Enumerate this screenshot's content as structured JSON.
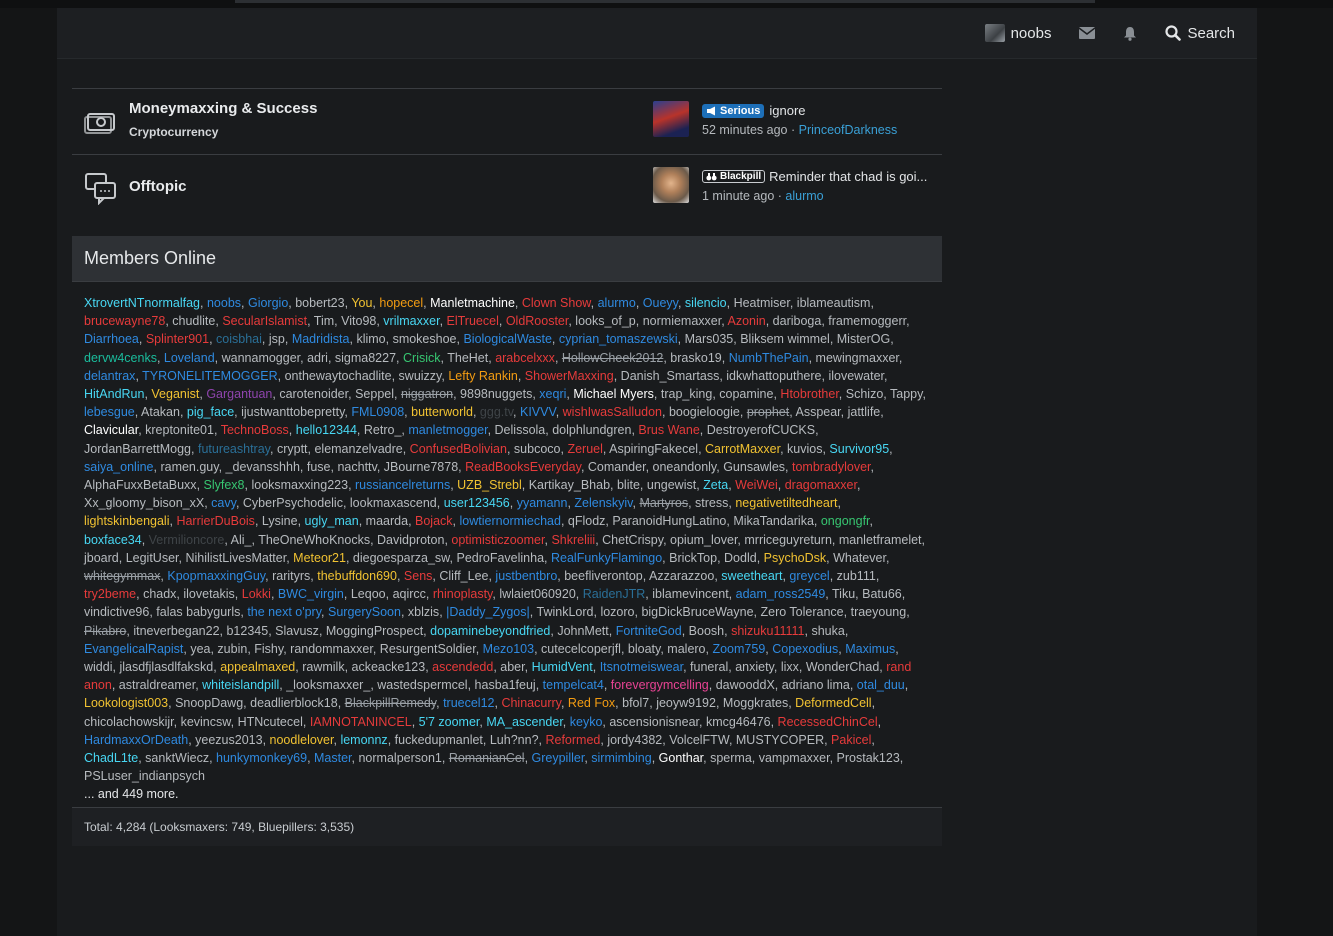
{
  "navbar": {
    "username": "noobs",
    "search_label": "Search",
    "icons": [
      "envelope-icon",
      "bell-icon",
      "search-icon"
    ]
  },
  "nodes": [
    {
      "title": "Moneymaxxing & Success",
      "subforum": "Cryptocurrency",
      "icon": "money-icon",
      "latest": {
        "prefix": "Serious",
        "thread_title": "ignore",
        "time": "52 minutes ago",
        "author": "PrinceofDarkness"
      }
    },
    {
      "title": "Offtopic",
      "icon": "chat-bubbles-icon",
      "latest": {
        "prefix": "Blackpill",
        "thread_title": "Reminder that chad is goi...",
        "time": "1 minute ago",
        "author": "alurmo"
      }
    }
  ],
  "members_online": {
    "heading": "Members Online",
    "more": "... and 449 more.",
    "total": "Total: 4,284 (Looksmaxers: 749, Bluepillers: 3,535)",
    "users": [
      [
        "XtrovertNTnormalfag",
        "cyan"
      ],
      [
        "noobs",
        "blue"
      ],
      [
        "Giorgio",
        "blue"
      ],
      [
        "bobert23",
        "def"
      ],
      [
        "You",
        "yellow"
      ],
      [
        "hopecel",
        "orange"
      ],
      [
        "Manletmachine",
        "white"
      ],
      [
        "Clown Show",
        "red"
      ],
      [
        "alurmo",
        "blue"
      ],
      [
        "Oueyy",
        "blue"
      ],
      [
        "silencio",
        "cyan"
      ],
      [
        "Heatmiser",
        "def"
      ],
      [
        "iblameautism",
        "def"
      ],
      [
        "brucewayne78",
        "red"
      ],
      [
        "chudlite",
        "def"
      ],
      [
        "SecularIslamist",
        "red"
      ],
      [
        "Tim",
        "def"
      ],
      [
        "Vito98",
        "def"
      ],
      [
        "vrilmaxxer",
        "cyan"
      ],
      [
        "ElTruecel",
        "red"
      ],
      [
        "OldRooster",
        "red"
      ],
      [
        "looks_of_p",
        "def"
      ],
      [
        "normiemaxxer",
        "def"
      ],
      [
        "Azonin",
        "red"
      ],
      [
        "dariboga",
        "def"
      ],
      [
        "framemoggerr",
        "def"
      ],
      [
        "Diarrhoea",
        "blue"
      ],
      [
        "Splinter901",
        "red"
      ],
      [
        "coisbhai",
        "dimblue"
      ],
      [
        "jsp",
        "def"
      ],
      [
        "Madridista",
        "blue"
      ],
      [
        "klimo",
        "def"
      ],
      [
        "smokeshoe",
        "def"
      ],
      [
        "BiologicalWaste",
        "blue"
      ],
      [
        "cyprian_tomaszewski",
        "blue"
      ],
      [
        "Mars035",
        "def"
      ],
      [
        "Bliksem wimmel",
        "def"
      ],
      [
        "MisterOG",
        "def"
      ],
      [
        "dervw4cenks",
        "teal"
      ],
      [
        "Loveland",
        "blue"
      ],
      [
        "wannamogger",
        "def"
      ],
      [
        "adri",
        "def"
      ],
      [
        "sigma8227",
        "def"
      ],
      [
        "Crisick",
        "green"
      ],
      [
        "TheHet",
        "def"
      ],
      [
        "arabcelxxx",
        "red"
      ],
      [
        "HollowCheek2012",
        "strike"
      ],
      [
        "brasko19",
        "def"
      ],
      [
        "NumbThePain",
        "blue"
      ],
      [
        "mewingmaxxer",
        "def"
      ],
      [
        "delantrax",
        "blue"
      ],
      [
        "TYRONELITEMOGGER",
        "blue"
      ],
      [
        "onthewaytochadlite",
        "def"
      ],
      [
        "swuizzy",
        "def"
      ],
      [
        "Lefty Rankin",
        "orange"
      ],
      [
        "ShowerMaxxing",
        "red"
      ],
      [
        "Danish_Smartass",
        "def"
      ],
      [
        "idkwhattoputhere",
        "def"
      ],
      [
        "ilovewater",
        "def"
      ],
      [
        "HitAndRun",
        "cyan"
      ],
      [
        "Veganist",
        "yellow"
      ],
      [
        "Gargantuan",
        "purple"
      ],
      [
        "carotenoider",
        "def"
      ],
      [
        "Seppel",
        "def"
      ],
      [
        "niggatron",
        "strike"
      ],
      [
        "9898nuggets",
        "def"
      ],
      [
        "xeqri",
        "blue"
      ],
      [
        "Michael Myers",
        "white"
      ],
      [
        "trap_king",
        "def"
      ],
      [
        "copamine",
        "def"
      ],
      [
        "Htobrother",
        "red"
      ],
      [
        "Schizo",
        "def"
      ],
      [
        "Tappy",
        "def"
      ],
      [
        "lebesgue",
        "blue"
      ],
      [
        "Atakan",
        "def"
      ],
      [
        "pig_face",
        "cyan"
      ],
      [
        "ijustwanttobepretty",
        "def"
      ],
      [
        "FML0908",
        "blue"
      ],
      [
        "butterworld",
        "yellow"
      ],
      [
        "ggg.tv",
        "dark"
      ],
      [
        "KIVVV",
        "blue"
      ],
      [
        "wishIwasSalludon",
        "red"
      ],
      [
        "boogieloogie",
        "def"
      ],
      [
        "prophet",
        "strike"
      ],
      [
        "Asspear",
        "def"
      ],
      [
        "jattlife",
        "def"
      ],
      [
        "Clavicular",
        "white"
      ],
      [
        "kreptonite01",
        "def"
      ],
      [
        "TechnoBoss",
        "red"
      ],
      [
        "hello12344",
        "cyan"
      ],
      [
        "Retro_",
        "def"
      ],
      [
        "manletmogger",
        "blue"
      ],
      [
        "Delissola",
        "def"
      ],
      [
        "dolphlundgren",
        "def"
      ],
      [
        "Brus Wane",
        "red"
      ],
      [
        "DestroyerofCUCKS",
        "def"
      ],
      [
        "JordanBarrettMogg",
        "def"
      ],
      [
        "futureashtray",
        "dimblue"
      ],
      [
        "cryptt",
        "def"
      ],
      [
        "elemanzelvadre",
        "def"
      ],
      [
        "ConfusedBolivian",
        "red"
      ],
      [
        "subcoco",
        "def"
      ],
      [
        "Zeruel",
        "red"
      ],
      [
        "AspiringFakecel",
        "def"
      ],
      [
        "CarrotMaxxer",
        "yellow"
      ],
      [
        "kuvios",
        "def"
      ],
      [
        "Survivor95",
        "cyan"
      ],
      [
        "saiya_online",
        "blue"
      ],
      [
        "ramen.guy",
        "def"
      ],
      [
        "_devansshhh",
        "def"
      ],
      [
        "fuse",
        "def"
      ],
      [
        "nachttv",
        "def"
      ],
      [
        "JBourne7878",
        "def"
      ],
      [
        "ReadBooksEveryday",
        "red"
      ],
      [
        "Comander",
        "def"
      ],
      [
        "oneandonly",
        "def"
      ],
      [
        "Gunsawles",
        "def"
      ],
      [
        "tombradylover",
        "red"
      ],
      [
        "AlphaFuxxBetaBuxx",
        "def"
      ],
      [
        "Slyfex8",
        "green"
      ],
      [
        "looksmaxxing223",
        "def"
      ],
      [
        "russiancelreturns",
        "blue"
      ],
      [
        "UZB_Strebl",
        "yellow"
      ],
      [
        "Kartikay_Bhab",
        "def"
      ],
      [
        "blite",
        "def"
      ],
      [
        "ungewist",
        "def"
      ],
      [
        "Zeta",
        "cyan"
      ],
      [
        "WeiWei",
        "red"
      ],
      [
        "dragomaxxer",
        "red"
      ],
      [
        "Xx_gloomy_bison_xX",
        "def"
      ],
      [
        "cavy",
        "blue"
      ],
      [
        "CyberPsychodelic",
        "def"
      ],
      [
        "lookmaxascend",
        "def"
      ],
      [
        "user123456",
        "cyan"
      ],
      [
        "yyamann",
        "blue"
      ],
      [
        "Zelenskyiv",
        "blue"
      ],
      [
        "Martyros",
        "strike"
      ],
      [
        "stress",
        "def"
      ],
      [
        "negativetiltedheart",
        "yellow"
      ],
      [
        "lightskinbengali",
        "yellow"
      ],
      [
        "HarrierDuBois",
        "red"
      ],
      [
        "Lysine",
        "def"
      ],
      [
        "ugly_man",
        "cyan"
      ],
      [
        "maarda",
        "def"
      ],
      [
        "Bojack",
        "red"
      ],
      [
        "lowtiernormiechad",
        "blue"
      ],
      [
        "qFlodz",
        "def"
      ],
      [
        "ParanoidHungLatino",
        "def"
      ],
      [
        "MikaTandarika",
        "def"
      ],
      [
        "ongongfr",
        "green"
      ],
      [
        "boxface34",
        "cyan"
      ],
      [
        "Vermilioncore",
        "dark"
      ],
      [
        "Ali_",
        "def"
      ],
      [
        "TheOneWhoKnocks",
        "def"
      ],
      [
        "Davidproton",
        "def"
      ],
      [
        "optimisticzoomer",
        "red"
      ],
      [
        "Shkreliii",
        "red"
      ],
      [
        "ChetCrispy",
        "def"
      ],
      [
        "opium_lover",
        "def"
      ],
      [
        "mrriceguyreturn",
        "def"
      ],
      [
        "manletframelet",
        "def"
      ],
      [
        "jboard",
        "def"
      ],
      [
        "LegitUser",
        "def"
      ],
      [
        "NihilistLivesMatter",
        "def"
      ],
      [
        "Meteor21",
        "yellow"
      ],
      [
        "diegoesparza_sw",
        "def"
      ],
      [
        "PedroFavelinha",
        "def"
      ],
      [
        "RealFunkyFlamingo",
        "blue"
      ],
      [
        "BrickTop",
        "def"
      ],
      [
        "Dodld",
        "def"
      ],
      [
        "PsychoDsk",
        "yellow"
      ],
      [
        "Whatever",
        "def"
      ],
      [
        "whitegymmax",
        "strike"
      ],
      [
        "KpopmaxxingGuy",
        "blue"
      ],
      [
        "rarityrs",
        "def"
      ],
      [
        "thebuffdon690",
        "yellow"
      ],
      [
        "Sens",
        "red"
      ],
      [
        "Cliff_Lee",
        "def"
      ],
      [
        "justbentbro",
        "blue"
      ],
      [
        "beefliverontop",
        "def"
      ],
      [
        "Azzarazzoo",
        "def"
      ],
      [
        "sweetheart",
        "cyan"
      ],
      [
        "greycel",
        "blue"
      ],
      [
        "zub111",
        "def"
      ],
      [
        "try2beme",
        "red"
      ],
      [
        "chadx",
        "def"
      ],
      [
        "ilovetakis",
        "def"
      ],
      [
        "Lokki",
        "red"
      ],
      [
        "BWC_virgin",
        "blue"
      ],
      [
        "Leqoo",
        "def"
      ],
      [
        "aqircc",
        "def"
      ],
      [
        "rhinoplasty",
        "red"
      ],
      [
        "lwlaiet060920",
        "def"
      ],
      [
        "RaidenJTR",
        "dimblue"
      ],
      [
        "iblamevincent",
        "def"
      ],
      [
        "adam_ross2549",
        "blue"
      ],
      [
        "Tiku",
        "def"
      ],
      [
        "Batu66",
        "def"
      ],
      [
        "vindictive96",
        "def"
      ],
      [
        "falas babygurls",
        "def"
      ],
      [
        "the next o'pry",
        "blue"
      ],
      [
        "SurgerySoon",
        "blue"
      ],
      [
        "xblzis",
        "def"
      ],
      [
        "|Daddy_Zygos|",
        "blue"
      ],
      [
        "TwinkLord",
        "def"
      ],
      [
        "lozoro",
        "def"
      ],
      [
        "bigDickBruceWayne",
        "def"
      ],
      [
        "Zero Tolerance",
        "def"
      ],
      [
        "traeyoung",
        "def"
      ],
      [
        "Pikabro",
        "strike"
      ],
      [
        "itneverbegan22",
        "def"
      ],
      [
        "b12345",
        "def"
      ],
      [
        "Slavusz",
        "def"
      ],
      [
        "MoggingProspect",
        "def"
      ],
      [
        "dopaminebeyondfried",
        "cyan"
      ],
      [
        "JohnMett",
        "def"
      ],
      [
        "FortniteGod",
        "blue"
      ],
      [
        "Boosh",
        "def"
      ],
      [
        "shizuku11111",
        "red"
      ],
      [
        "shuka",
        "def"
      ],
      [
        "EvangelicalRapist",
        "blue"
      ],
      [
        "yea",
        "def"
      ],
      [
        "zubin",
        "def"
      ],
      [
        "Fishy",
        "def"
      ],
      [
        "randommaxxer",
        "def"
      ],
      [
        "ResurgentSoldier",
        "def"
      ],
      [
        "Mezo103",
        "blue"
      ],
      [
        "cutecelcoperjfl",
        "def"
      ],
      [
        "bloaty",
        "def"
      ],
      [
        "malero",
        "def"
      ],
      [
        "Zoom759",
        "blue"
      ],
      [
        "Copexodius",
        "blue"
      ],
      [
        "Maximus",
        "blue"
      ],
      [
        "widdi",
        "def"
      ],
      [
        "jlasdfjlasdlfakskd",
        "def"
      ],
      [
        "appealmaxed",
        "yellow"
      ],
      [
        "rawmilk",
        "def"
      ],
      [
        "ackeacke123",
        "def"
      ],
      [
        "ascendedd",
        "red"
      ],
      [
        "aber",
        "def"
      ],
      [
        "HumidVent",
        "cyan"
      ],
      [
        "Itsnotmeiswear",
        "blue"
      ],
      [
        "funeral",
        "def"
      ],
      [
        "anxiety",
        "def"
      ],
      [
        "lixx",
        "def"
      ],
      [
        "WonderChad",
        "def"
      ],
      [
        "rand anon",
        "red"
      ],
      [
        "astraldreamer",
        "def"
      ],
      [
        "whiteislandpill",
        "cyan"
      ],
      [
        "_looksmaxxer_",
        "def"
      ],
      [
        "wastedspermcel",
        "def"
      ],
      [
        "hasba1feuj",
        "def"
      ],
      [
        "tempelcat4",
        "blue"
      ],
      [
        "forevergymcelling",
        "pink"
      ],
      [
        "dawooddX",
        "def"
      ],
      [
        "adriano lima",
        "def"
      ],
      [
        "otal_duu",
        "blue"
      ],
      [
        "Lookologist003",
        "yellow"
      ],
      [
        "SnoopDawg",
        "def"
      ],
      [
        "deadlierblock18",
        "def"
      ],
      [
        "BlackpillRemedy",
        "strike"
      ],
      [
        "truecel12",
        "blue"
      ],
      [
        "Chinacurry",
        "red"
      ],
      [
        "Red Fox",
        "orange"
      ],
      [
        "bfol7",
        "def"
      ],
      [
        "jeoyw9192",
        "def"
      ],
      [
        "Moggkrates",
        "def"
      ],
      [
        "DeformedCell",
        "yellow"
      ],
      [
        "chicolachowskijr",
        "def"
      ],
      [
        "kevincsw",
        "def"
      ],
      [
        "HTNcutecel",
        "def"
      ],
      [
        "IAMNOTANINCEL",
        "red"
      ],
      [
        "5'7 zoomer",
        "cyan"
      ],
      [
        "MA_ascender",
        "cyan"
      ],
      [
        "keyko",
        "blue"
      ],
      [
        "ascensionisnear",
        "def"
      ],
      [
        "kmcg46476",
        "def"
      ],
      [
        "RecessedChinCel",
        "red"
      ],
      [
        "HardmaxxOrDeath",
        "blue"
      ],
      [
        "yeezus2013",
        "def"
      ],
      [
        "noodlelover",
        "yellow"
      ],
      [
        "lemonnz",
        "cyan"
      ],
      [
        "fuckedupmanlet",
        "def"
      ],
      [
        "Luh?nn?",
        "def"
      ],
      [
        "Reformed",
        "red"
      ],
      [
        "jordy4382",
        "def"
      ],
      [
        "VolcelFTW",
        "def"
      ],
      [
        "MUSTYCOPER",
        "def"
      ],
      [
        "Pakicel",
        "red"
      ],
      [
        "ChadL1te",
        "cyan"
      ],
      [
        "sanktWiecz",
        "def"
      ],
      [
        "hunkymonkey69",
        "blue"
      ],
      [
        "Master",
        "blue"
      ],
      [
        "normalperson1",
        "def"
      ],
      [
        "RomanianCel",
        "strike"
      ],
      [
        "Greypiller",
        "blue"
      ],
      [
        "sirmimbing",
        "blue"
      ],
      [
        "Gonthar",
        "white"
      ],
      [
        "sperma",
        "def"
      ],
      [
        "vampmaxxer",
        "def"
      ],
      [
        "Prostak123",
        "def"
      ],
      [
        "PSLuser_indianpsych",
        "def"
      ]
    ]
  }
}
